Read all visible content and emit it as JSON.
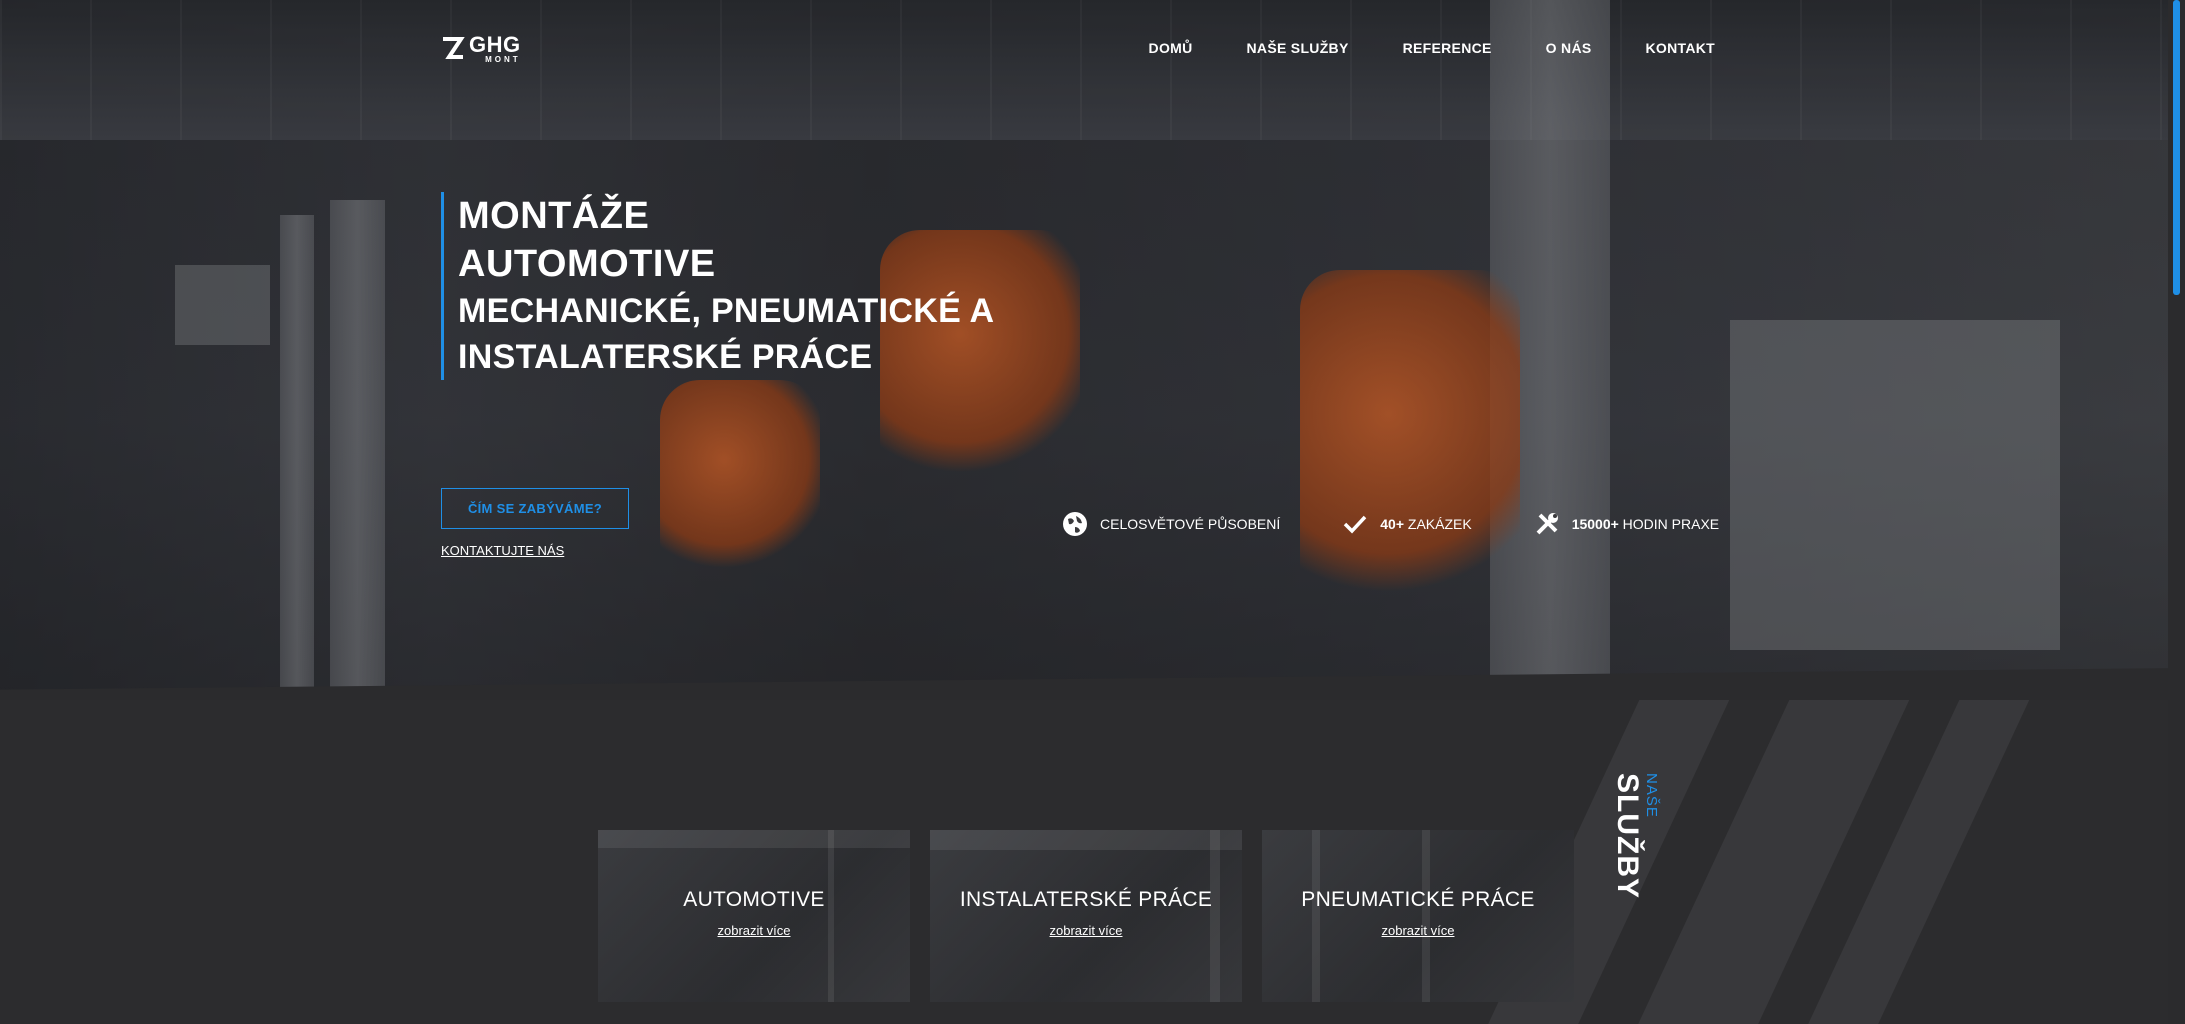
{
  "brand": {
    "name": "GHG",
    "sub": "MONT"
  },
  "nav": [
    {
      "label": "DOMŮ"
    },
    {
      "label": "NAŠE SLUŽBY"
    },
    {
      "label": "REFERENCE"
    },
    {
      "label": "O NÁS"
    },
    {
      "label": "KONTAKT"
    }
  ],
  "hero": {
    "line1": "MONTÁŽE",
    "line2": "AUTOMOTIVE",
    "line3": "MECHANICKÉ, PNEUMATICKÉ A INSTALATERSKÉ PRÁCE",
    "cta": "ČÍM SE ZABÝVÁME?",
    "contact_link": "KONTAKTUJTE NÁS"
  },
  "features": [
    {
      "icon": "globe-icon",
      "bold": "",
      "text": "CELOSVĚTOVÉ PŮSOBENÍ"
    },
    {
      "icon": "check-icon",
      "bold": "40+",
      "text": " ZAKÁZEK"
    },
    {
      "icon": "tools-icon",
      "bold": "15000+",
      "text": " HODIN PRAXE"
    }
  ],
  "services": {
    "title_small": "NAŠE",
    "title_big": "SLUŽBY",
    "cards": [
      {
        "title": "AUTOMOTIVE",
        "link": "zobrazit více"
      },
      {
        "title": "INSTALATERSKÉ PRÁCE",
        "link": "zobrazit více"
      },
      {
        "title": "PNEUMATICKÉ PRÁCE",
        "link": "zobrazit více"
      }
    ]
  },
  "colors": {
    "accent": "#1f8fe6",
    "background": "#2b2b2d"
  }
}
